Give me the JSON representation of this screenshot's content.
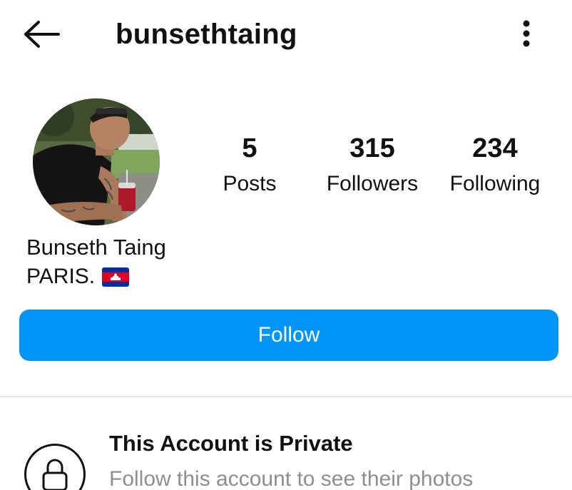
{
  "header": {
    "username": "bunsethtaing",
    "back_icon": "arrow-left-icon",
    "more_icon": "vertical-ellipsis-icon"
  },
  "profile": {
    "avatar_icon": "profile-photo",
    "stats": {
      "posts": {
        "value": "5",
        "label": "Posts"
      },
      "followers": {
        "value": "315",
        "label": "Followers"
      },
      "following": {
        "value": "234",
        "label": "Following"
      }
    },
    "full_name": "Bunseth Taing",
    "bio": "PARIS.",
    "bio_flag_icon": "cambodia-flag-icon"
  },
  "actions": {
    "follow_label": "Follow"
  },
  "private_notice": {
    "icon": "lock-icon",
    "title": "This Account is Private",
    "subtitle": "Follow this account to see their photos"
  },
  "colors": {
    "accent": "#0095f6",
    "text": "#111111",
    "muted_text": "#8e8e8e",
    "divider": "#e6e6e6"
  }
}
